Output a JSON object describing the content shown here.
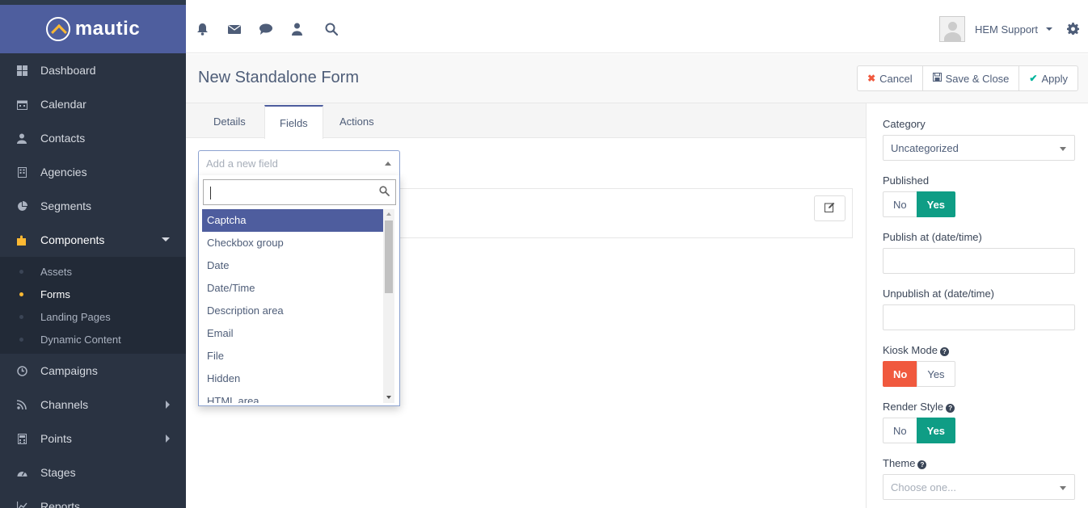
{
  "brand": {
    "name": "mautic"
  },
  "sidebar": {
    "items": [
      {
        "label": "Dashboard",
        "icon": "dashboard-icon"
      },
      {
        "label": "Calendar",
        "icon": "calendar-icon"
      },
      {
        "label": "Contacts",
        "icon": "user-icon"
      },
      {
        "label": "Agencies",
        "icon": "building-icon"
      },
      {
        "label": "Segments",
        "icon": "pie-chart-icon"
      },
      {
        "label": "Components",
        "icon": "puzzle-icon"
      },
      {
        "label": "Campaigns",
        "icon": "clock-icon"
      },
      {
        "label": "Channels",
        "icon": "rss-icon"
      },
      {
        "label": "Points",
        "icon": "calculator-icon"
      },
      {
        "label": "Stages",
        "icon": "tachometer-icon"
      },
      {
        "label": "Reports",
        "icon": "line-chart-icon"
      }
    ],
    "components_sub": [
      "Assets",
      "Forms",
      "Landing Pages",
      "Dynamic Content"
    ],
    "active_sub": "Forms"
  },
  "header": {
    "user_name": "HEM Support"
  },
  "page": {
    "title": "New Standalone Form",
    "cancel_label": "Cancel",
    "save_close_label": "Save & Close",
    "apply_label": "Apply"
  },
  "tabs": [
    "Details",
    "Fields",
    "Actions"
  ],
  "active_tab": "Fields",
  "field_select": {
    "placeholder": "Add a new field",
    "search_value": "",
    "options": [
      "Captcha",
      "Checkbox group",
      "Date",
      "Date/Time",
      "Description area",
      "Email",
      "File",
      "Hidden",
      "HTML area"
    ],
    "highlighted": "Captcha"
  },
  "right_panel": {
    "category_label": "Category",
    "category_value": "Uncategorized",
    "published_label": "Published",
    "publish_at_label": "Publish at (date/time)",
    "unpublish_at_label": "Unpublish at (date/time)",
    "kiosk_label": "Kiosk Mode",
    "render_label": "Render Style",
    "theme_label": "Theme",
    "theme_placeholder": "Choose one...",
    "no_label": "No",
    "yes_label": "Yes",
    "published": "Yes",
    "kiosk_mode": "No",
    "render_style": "Yes"
  },
  "colors": {
    "brand_bar": "#4e5e9e",
    "sidebar_bg": "#2a3342",
    "toggle_yes": "#0f9d85",
    "toggle_no": "#f0593e",
    "highlight": "#4e5d9e",
    "active_dot": "#fdb933"
  }
}
